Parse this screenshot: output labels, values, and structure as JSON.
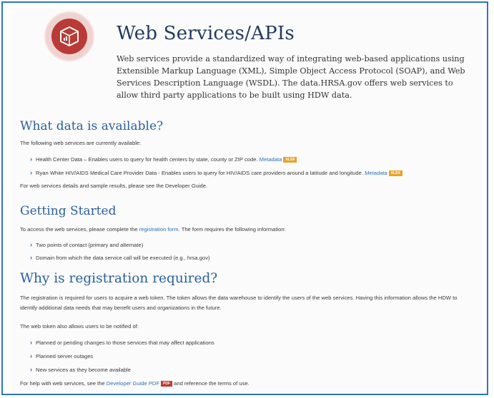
{
  "page": {
    "title": "Web Services/APIs",
    "intro": "Web services provide a standardized way of integrating web-based applications using Extensible Markup Language (XML), Simple Object Access Protocol (SOAP), and Web Services Description Language (WSDL). The data.HRSA.gov offers web services to allow third party applications to be built using HDW data.",
    "icon": "cube-chart-icon",
    "accent_color": "#b93a36"
  },
  "what_data": {
    "heading": "What data is available?",
    "lead": "The following web services are currently available:",
    "items": [
      {
        "text": "Health Center Data – Enables users to query for health centers by state, county or ZIP code.",
        "link": "Metadata",
        "badge": "XLSX"
      },
      {
        "text": "Ryan White HIV/AIDS Medical Care Provider Data - Enables users to query for HIV/AIDS care providers around a latitude and longitude.",
        "link": "Metadata",
        "badge": "XLSX"
      }
    ],
    "footer": "For web services details and sample results, please see the Developer Guide."
  },
  "getting_started": {
    "heading": "Getting Started",
    "lead_before": "To access the web services, please complete the ",
    "lead_link": "registration form",
    "lead_after": ". The form requires the following information:",
    "items": [
      "Two points of contact (primary and alternate)",
      "Domain from which the data service call will be executed (e.g., hrsa.gov)"
    ]
  },
  "why_registration": {
    "heading": "Why is registration required?",
    "para": "The registration is required for users to acquire a web token. The token allows the data warehouse to identify the users of the web services. Having this information allows the HDW to identify additional data needs that may benefit users and organizations in the future.",
    "notify_lead": "The web token also allows users to be notified of:",
    "items": [
      "Planned or pending changes to those services that may affect applications",
      "Planned server outages",
      "New services as they become available"
    ],
    "help_before": "For help with web services, see the ",
    "help_link": "Developer Guide PDF",
    "help_badge": "PDF",
    "help_after": " and reference the terms of use."
  }
}
